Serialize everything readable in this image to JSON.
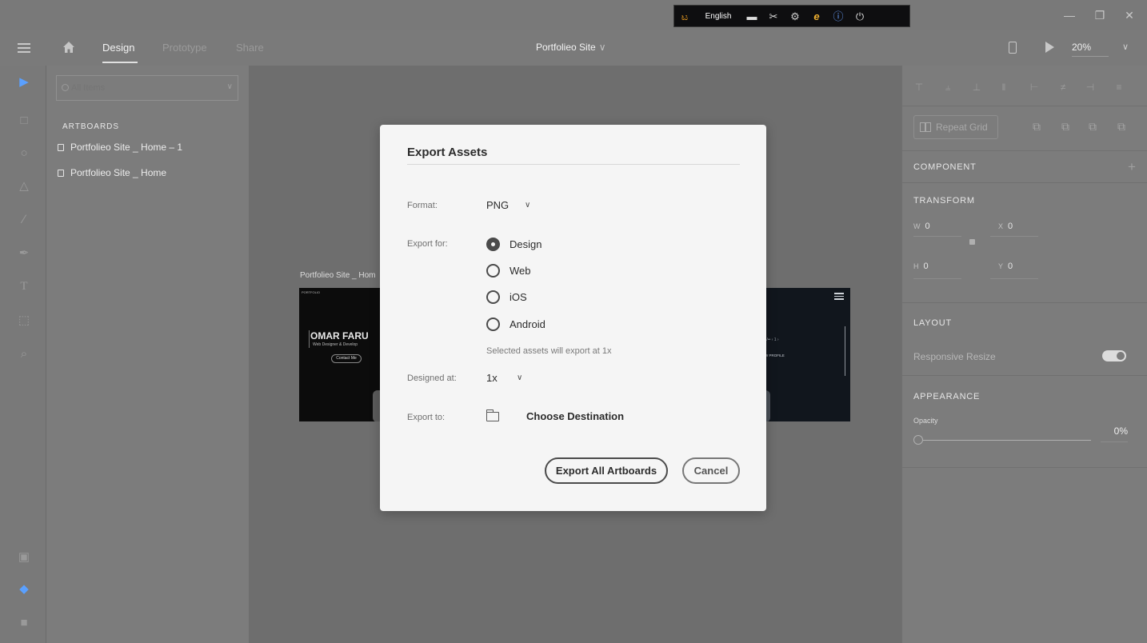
{
  "ime": {
    "language": "English"
  },
  "header": {
    "tabs": [
      "Design",
      "Prototype",
      "Share"
    ],
    "doc_title": "Portfolieo Site",
    "zoom": "20%"
  },
  "layers": {
    "search_placeholder": "All Items",
    "artboards_heading": "ARTBOARDS",
    "items": [
      "Portfolieo Site _ Home – 1",
      "Portfolieo Site _ Home"
    ]
  },
  "canvas": {
    "artboard_label": "Portfolieo Site _ Hom",
    "left_preview": {
      "logo": "PORTFOLIO",
      "name": "OMAR FARU",
      "subtitle": "Web Designer & Develop",
      "button": "Contact Me"
    },
    "right_preview": {
      "line1": "I/••        ‹ 1 ›",
      "line2": "EW PROFILE"
    }
  },
  "properties": {
    "repeat_grid": "Repeat Grid",
    "component": "COMPONENT",
    "transform": "TRANSFORM",
    "w_label": "W",
    "w_value": "0",
    "x_label": "X",
    "x_value": "0",
    "h_label": "H",
    "h_value": "0",
    "y_label": "Y",
    "y_value": "0",
    "layout": "LAYOUT",
    "responsive_resize": "Responsive Resize",
    "responsive_resize_on": true,
    "appearance": "APPEARANCE",
    "opacity_label": "Opacity",
    "opacity_value": "0%"
  },
  "dialog": {
    "title": "Export Assets",
    "format_label": "Format:",
    "format_value": "PNG",
    "export_for_label": "Export for:",
    "options": [
      "Design",
      "Web",
      "iOS",
      "Android"
    ],
    "selected_option": "Design",
    "note": "Selected assets will export at 1x",
    "designed_at_label": "Designed at:",
    "designed_at_value": "1x",
    "export_to_label": "Export to:",
    "choose_destination": "Choose Destination",
    "export_button": "Export All Artboards",
    "cancel_button": "Cancel"
  },
  "colors": {
    "dialog_bg": "#f5f5f5",
    "panel_bg": "#7c7c7c",
    "canvas_bg": "#6e6e6e"
  }
}
